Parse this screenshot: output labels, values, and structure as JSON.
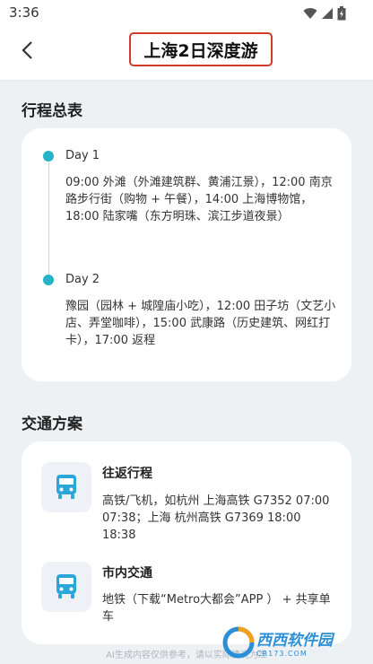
{
  "status_bar": {
    "time": "3:36",
    "icons": [
      "wifi-icon",
      "signal-icon",
      "battery-icon"
    ]
  },
  "header": {
    "title": "上海2日深度游",
    "back_icon": "chevron-left-icon"
  },
  "itinerary": {
    "section_title": "行程总表",
    "days": [
      {
        "label": "Day 1",
        "text": "09:00 外滩（外滩建筑群、黄浦江景），12:00 南京路步行街（购物 + 午餐），14:00 上海博物馆，18:00 陆家嘴（东方明珠、滨江步道夜景）"
      },
      {
        "label": "Day 2",
        "text": "豫园（园林 + 城隍庙小吃），12:00 田子坊（文艺小店、弄堂咖啡），15:00 武康路（历史建筑、网红打卡），17:00 返程"
      }
    ]
  },
  "transport": {
    "section_title": "交通方案",
    "items": [
      {
        "icon": "bus-icon",
        "title": "往返行程",
        "text": "高铁/飞机，如杭州  上海高铁 G7352 07:00  07:38；上海  杭州高铁 G7369 18:00  18:38"
      },
      {
        "icon": "bus-icon",
        "title": "市内交通",
        "text": "地铁（下载“Metro大都会”APP ） + 共享单车"
      }
    ]
  },
  "footer": {
    "disclaimer": "AI生成内容仅供参考，请以实际情况为准"
  },
  "watermark": {
    "text": "西西软件园",
    "subtext": "CR173.COM"
  },
  "colors": {
    "accent": "#26b3c7",
    "title_border": "#d23a2a",
    "bus_icon": "#2aa7d8",
    "background": "#eef1f4"
  }
}
